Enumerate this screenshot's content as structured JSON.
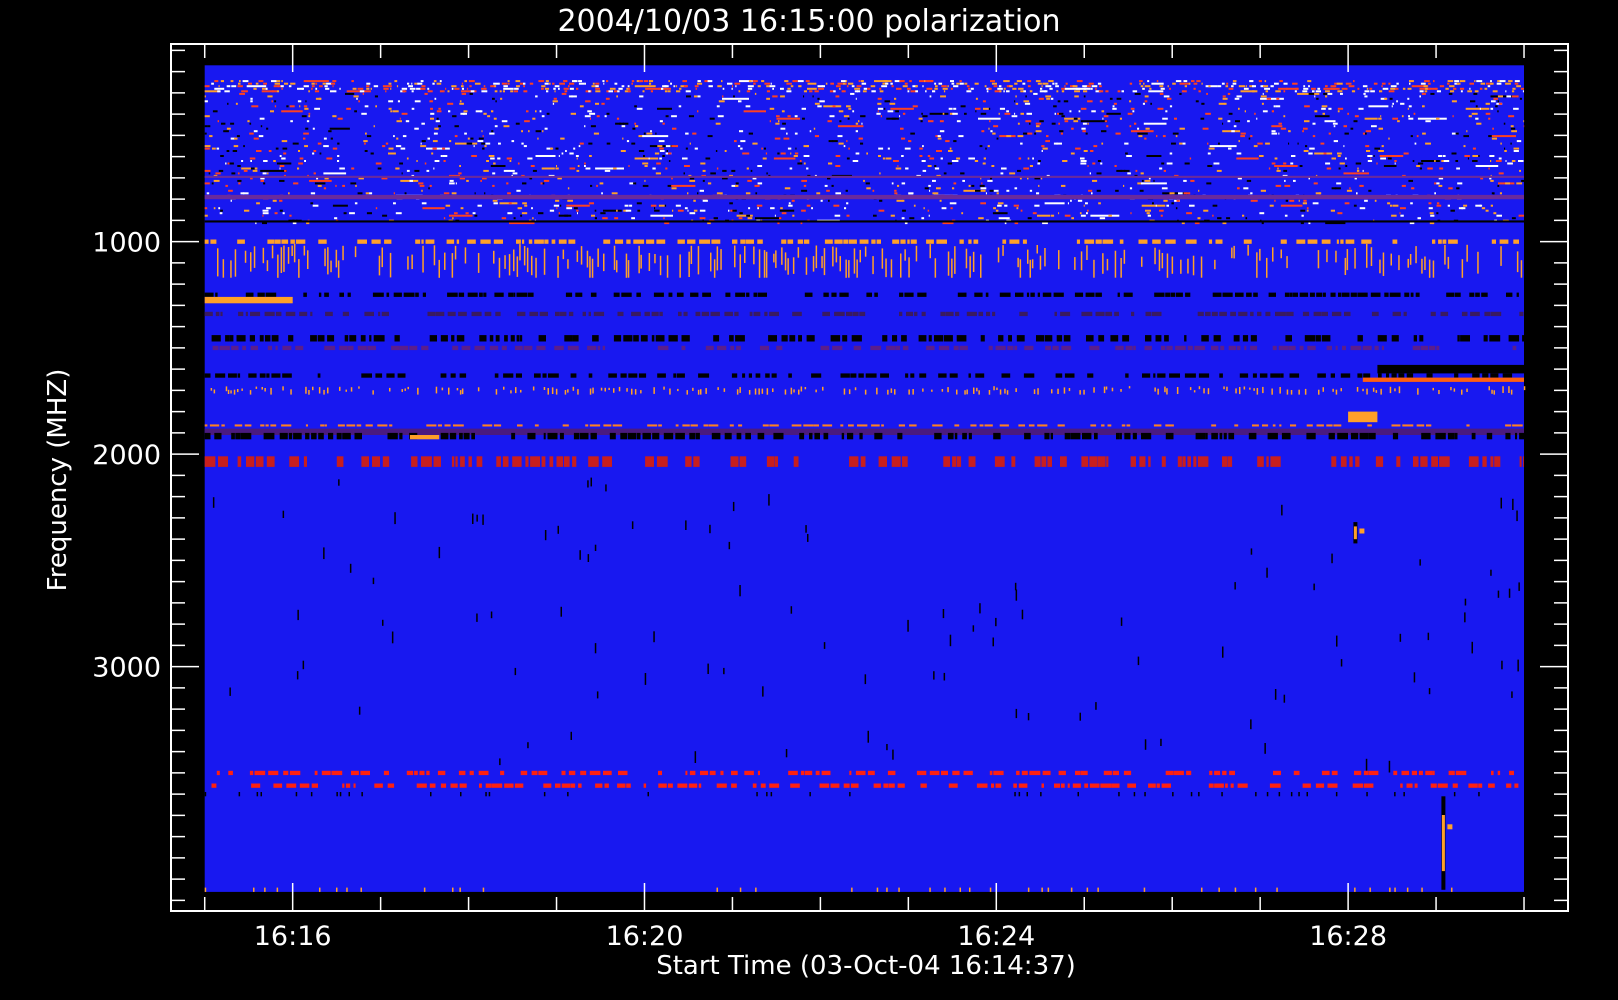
{
  "chart_data": {
    "type": "heatmap",
    "title": "2004/10/03 16:15:00 polarization",
    "xlabel": "Start Time (03-Oct-04 16:14:37)",
    "ylabel": "Frequency (MHZ)",
    "x_range": [
      "16:14:37",
      "16:30:30"
    ],
    "data_time_range": [
      "16:15:00",
      "16:30:00"
    ],
    "y_range_mhz": [
      70,
      4150
    ],
    "data_freq_range_mhz": [
      170,
      4060
    ],
    "y_orientation": "increasing-downward",
    "x_major_ticks": [
      {
        "value": "16:16",
        "label": "16:16"
      },
      {
        "value": "16:20",
        "label": "16:20"
      },
      {
        "value": "16:24",
        "label": "16:24"
      },
      {
        "value": "16:28",
        "label": "16:28"
      }
    ],
    "x_minor_tick_step_minutes": 1,
    "y_major_ticks": [
      {
        "value": 1000,
        "label": "1000"
      },
      {
        "value": 2000,
        "label": "2000"
      },
      {
        "value": 3000,
        "label": "3000"
      }
    ],
    "y_minor_tick_step_mhz": 100,
    "grid": false,
    "legend": "none",
    "colormap": {
      "background": "#1818f0",
      "levels": [
        "#000000",
        "#5a1e8c",
        "#c81e1e",
        "#ff3c00",
        "#ffa028",
        "#ffffff"
      ]
    },
    "bands": [
      {
        "f0": 240,
        "f1": 300,
        "style": "dense-speckle",
        "colors": [
          "#ff4020",
          "#ffa028",
          "#ffffff"
        ]
      },
      {
        "f0": 300,
        "f1": 920,
        "style": "speckle",
        "colors": [
          "#ff4020",
          "#ffa028",
          "#ffffff",
          "#000000"
        ]
      },
      {
        "f0": 690,
        "f1": 700,
        "style": "solid",
        "color": "#6a2a9c"
      },
      {
        "f0": 780,
        "f1": 800,
        "style": "solid",
        "color": "#6a2a9c"
      },
      {
        "f0": 900,
        "f1": 910,
        "style": "solid",
        "color": "#000000"
      },
      {
        "f0": 990,
        "f1": 1010,
        "style": "dashed",
        "color": "#ffa028"
      },
      {
        "f0": 1010,
        "f1": 1170,
        "style": "vertical-streaks",
        "color": "#ffa028"
      },
      {
        "f0": 1240,
        "f1": 1260,
        "style": "dashed",
        "color": "#000000"
      },
      {
        "f0": 1260,
        "f1": 1290,
        "style": "segment",
        "color": "#ffa028",
        "t0": "16:15:00",
        "t1": "16:16:00"
      },
      {
        "f0": 1330,
        "f1": 1350,
        "style": "dashed",
        "color": "#3a1a60"
      },
      {
        "f0": 1440,
        "f1": 1470,
        "style": "dashed",
        "color": "#000000"
      },
      {
        "f0": 1490,
        "f1": 1510,
        "style": "dashed",
        "color": "#5a1e8c"
      },
      {
        "f0": 1580,
        "f1": 1620,
        "style": "segment",
        "color": "#000000",
        "t0": "16:28:20",
        "t1": "16:30:00"
      },
      {
        "f0": 1620,
        "f1": 1640,
        "style": "dashed",
        "color": "#000000"
      },
      {
        "f0": 1640,
        "f1": 1660,
        "style": "segment",
        "color": "#ff6010",
        "t0": "16:28:10",
        "t1": "16:30:00"
      },
      {
        "f0": 1680,
        "f1": 1720,
        "style": "vertical-streaks",
        "color": "#ffa028"
      },
      {
        "f0": 1800,
        "f1": 1850,
        "style": "segment",
        "color": "#ffa028",
        "t0": "16:28:00",
        "t1": "16:28:20"
      },
      {
        "f0": 1860,
        "f1": 1870,
        "style": "dashed",
        "color": "#ff8020"
      },
      {
        "f0": 1880,
        "f1": 1910,
        "style": "solid",
        "color": "#4a1a80"
      },
      {
        "f0": 1900,
        "f1": 1930,
        "style": "dashed",
        "color": "#000000"
      },
      {
        "f0": 1910,
        "f1": 1930,
        "style": "segment",
        "color": "#ffa028",
        "t0": "16:17:20",
        "t1": "16:17:40"
      },
      {
        "f0": 2010,
        "f1": 2060,
        "style": "dashed",
        "color": "#c81e1e"
      },
      {
        "f0": 3490,
        "f1": 3510,
        "style": "dashed",
        "color": "#ff2010"
      },
      {
        "f0": 3550,
        "f1": 3570,
        "style": "dashed",
        "color": "#ff2010"
      },
      {
        "f0": 3590,
        "f1": 3610,
        "style": "sparse-ticks",
        "color": "#000000"
      },
      {
        "f0": 4040,
        "f1": 4060,
        "style": "sparse-ticks",
        "color": "#ffa028"
      }
    ],
    "features": [
      {
        "type": "burst",
        "t": "16:28:05",
        "f0": 2320,
        "f1": 2420,
        "color": "#ffa028"
      },
      {
        "type": "burst",
        "t": "16:29:05",
        "f0": 3610,
        "f1": 4050,
        "color": "#ffa028"
      }
    ]
  }
}
